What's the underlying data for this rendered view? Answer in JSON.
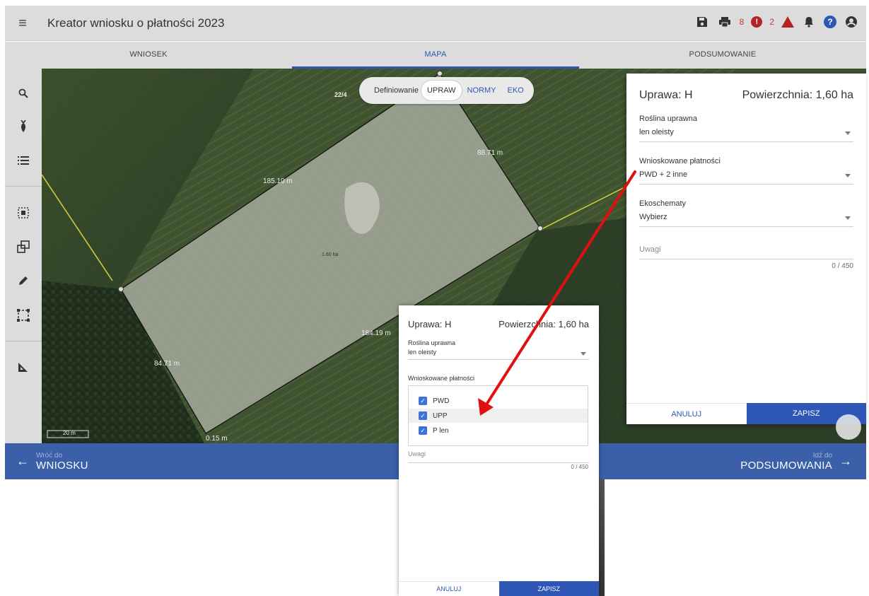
{
  "header": {
    "app_title": "Kreator wniosku o płatności 2023",
    "error_count": "8",
    "warning_count": "2",
    "error_icon_text": "!",
    "help_icon_text": "?"
  },
  "tabs": [
    {
      "label": "WNIOSEK",
      "active": false
    },
    {
      "label": "MAPA",
      "active": true
    },
    {
      "label": "PODSUMOWANIE",
      "active": false
    }
  ],
  "map": {
    "parcel_id": "22/4",
    "edge_labels": [
      "185.10 m",
      "88.71 m",
      "184.19 m",
      "84.71 m",
      "0.15 m"
    ],
    "area_label": "1.60 ha",
    "scale_label": "20 m",
    "definer": {
      "label": "Definiowanie",
      "options": [
        "UPRAW",
        "NORMY",
        "EKO"
      ],
      "selected": "UPRAW"
    }
  },
  "panel": {
    "title": "Uprawa: H",
    "area": "Powierzchnia: 1,60 ha",
    "crop_label": "Roślina uprawna",
    "crop_value": "len oleisty",
    "payments_label": "Wnioskowane płatności",
    "payments_value": "PWD + 2 inne",
    "eco_label": "Ekoschematy",
    "eco_value": "Wybierz",
    "notes_placeholder": "Uwagi",
    "notes_counter": "0 / 450",
    "cancel_label": "ANULUJ",
    "save_label": "ZAPISZ"
  },
  "popup": {
    "title": "Uprawa: H",
    "area": "Powierzchnia: 1,60 ha",
    "crop_label": "Roślina uprawna",
    "crop_value": "len oleisty",
    "payments_label": "Wnioskowane płatności",
    "payment_options": [
      {
        "label": "PWD",
        "checked": true
      },
      {
        "label": "UPP",
        "checked": true
      },
      {
        "label": "P len",
        "checked": true
      }
    ],
    "notes_placeholder": "Uwagi",
    "notes_counter": "0 / 450",
    "cancel_label": "ANULUJ",
    "save_label": "ZAPISZ"
  },
  "bottom_nav": {
    "back_small": "Wróć do",
    "back_big": "WNIOSKU",
    "next_small": "Idź do",
    "next_big": "PODSUMOWANIA"
  },
  "colors": {
    "accent": "#2e57b5",
    "nav_bar": "#3b5fa8",
    "error": "#b32424",
    "annotation_arrow": "#e01010"
  }
}
